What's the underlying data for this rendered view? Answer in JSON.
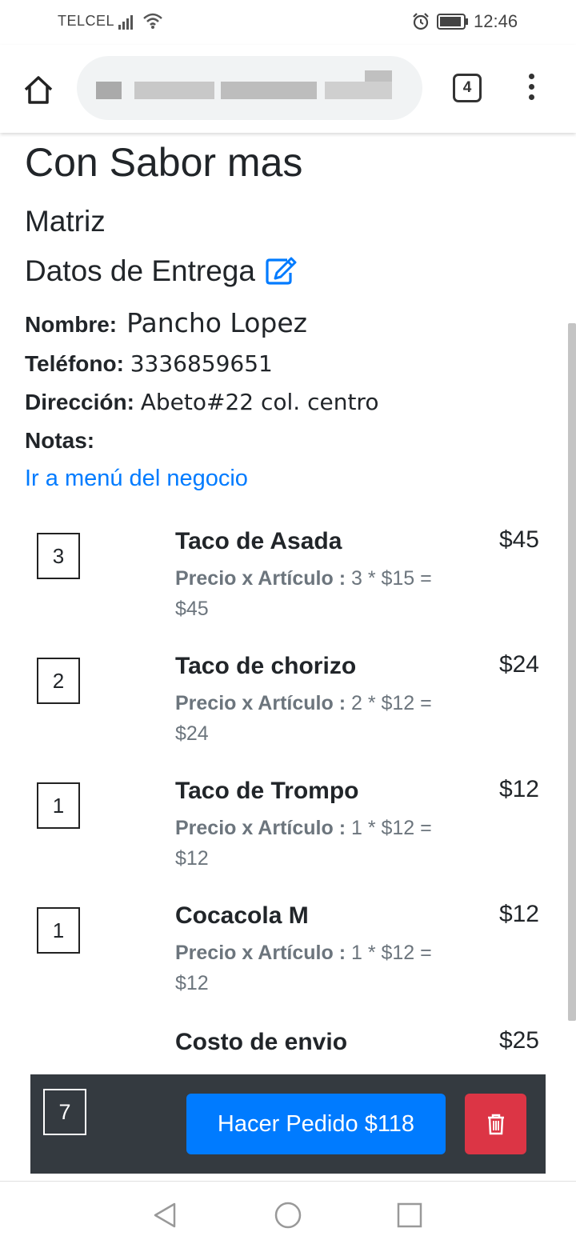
{
  "status_bar": {
    "carrier": "TELCEL",
    "time": "12:46"
  },
  "browser": {
    "tab_count": "4"
  },
  "business": {
    "name": "Con Sabor mas",
    "branch": "Matriz"
  },
  "delivery": {
    "header": "Datos de Entrega",
    "name_label": "Nombre:",
    "name_value": "Pancho Lopez",
    "phone_label": "Teléfono:",
    "phone_value": "3336859651",
    "address_label": "Dirección:",
    "address_value": "Abeto#22 col. centro",
    "notes_label": "Notas:",
    "notes_value": ""
  },
  "menu_link": "Ir a menú del negocio",
  "items": [
    {
      "qty": "3",
      "name": "Taco de Asada",
      "detail_label": "Precio x Artículo :",
      "detail_calc": "3 * $15 =",
      "detail_total": "$45",
      "price": "$45"
    },
    {
      "qty": "2",
      "name": "Taco de chorizo",
      "detail_label": "Precio x Artículo :",
      "detail_calc": "2 * $12 =",
      "detail_total": "$24",
      "price": "$24"
    },
    {
      "qty": "1",
      "name": "Taco de Trompo",
      "detail_label": "Precio x Artículo :",
      "detail_calc": "1 * $12 =",
      "detail_total": "$12",
      "price": "$12"
    },
    {
      "qty": "1",
      "name": "Cocacola M",
      "detail_label": "Precio x Artículo :",
      "detail_calc": "1 * $12 =",
      "detail_total": "$12",
      "price": "$12"
    }
  ],
  "shipping": {
    "label": "Costo de envio",
    "price": "$25"
  },
  "action_bar": {
    "total_qty": "7",
    "order_button": "Hacer Pedido $118"
  },
  "colors": {
    "primary": "#007bff",
    "danger": "#dc3545",
    "dark_bar": "#343a40",
    "muted": "#6c757d"
  }
}
